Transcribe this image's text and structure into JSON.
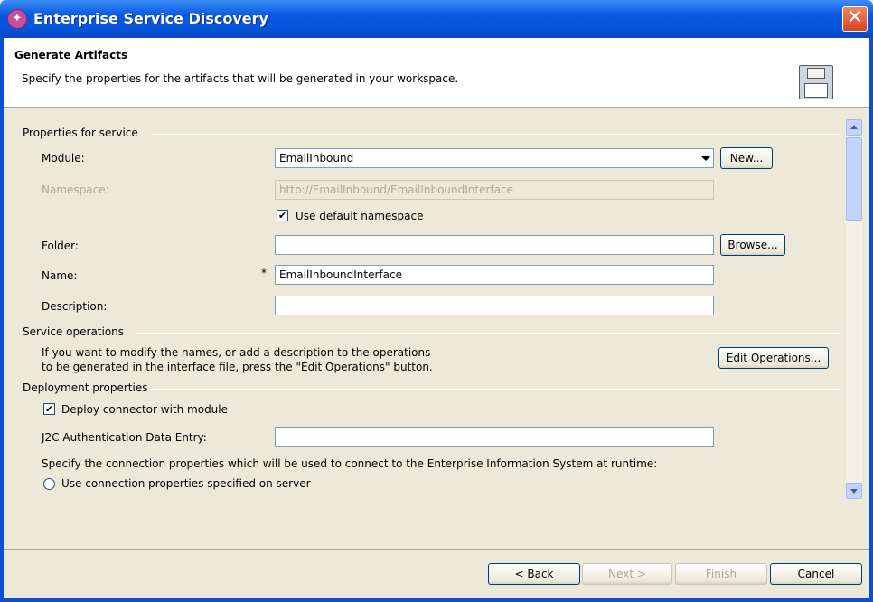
{
  "window": {
    "title": "Enterprise Service Discovery",
    "close_glyph": "✕",
    "app_icon_glyph": "✦"
  },
  "header": {
    "title": "Generate Artifacts",
    "description": "Specify the properties for the artifacts that will be generated in your workspace."
  },
  "properties": {
    "section_title": "Properties for service",
    "module_label": "Module:",
    "module_value": "EmailInbound",
    "new_button": "New...",
    "namespace_label": "Namespace:",
    "namespace_value": "http://EmailInbound/EmailInboundInterface",
    "use_default_namespace_label": "Use default namespace",
    "use_default_namespace_checked": true,
    "folder_label": "Folder:",
    "folder_value": "",
    "browse_button": "Browse...",
    "name_label": "Name:",
    "name_required_marker": "*",
    "name_value": "EmailInboundInterface",
    "description_label": "Description:",
    "description_value": ""
  },
  "service_operations": {
    "section_title": "Service operations",
    "text_line1": "If you want to modify the names, or add a description to the operations",
    "text_line2": "to be generated in the interface file, press the \"Edit Operations\" button.",
    "edit_button": "Edit Operations..."
  },
  "deployment": {
    "section_title": "Deployment properties",
    "deploy_connector_label": "Deploy connector with module",
    "deploy_connector_checked": true,
    "j2c_label": "J2C Authentication Data Entry:",
    "j2c_value": "",
    "connection_text": "Specify the connection properties which will be used to connect to the Enterprise Information System at runtime:",
    "use_server_props_label": "Use connection properties specified on server",
    "check_glyph": "✔"
  },
  "footer": {
    "back_button": "< Back",
    "next_button": "Next >",
    "finish_button": "Finish",
    "cancel_button": "Cancel"
  }
}
